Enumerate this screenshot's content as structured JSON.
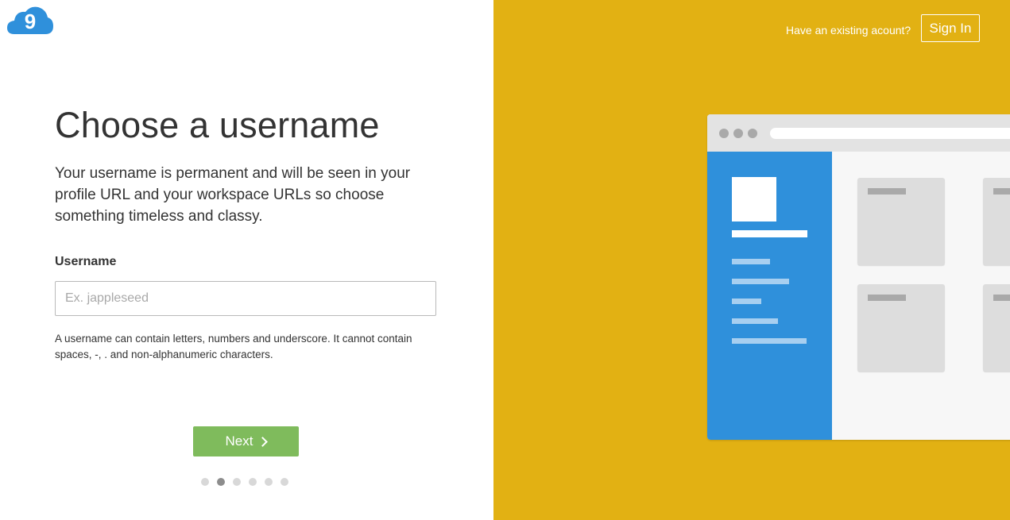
{
  "logo": {
    "icon": "cloud9-logo-icon",
    "glyph": "9",
    "color": "#2f90db"
  },
  "main": {
    "title": "Choose a username",
    "description": "Your username is permanent and will be seen in your profile URL and your workspace URLs so choose something timeless and classy.",
    "username_label": "Username",
    "username_value": "",
    "username_placeholder": "Ex. jappleseed",
    "hint": "A username can contain letters, numbers and underscore. It cannot contain spaces, -, . and non-alphanumeric characters.",
    "next_label": "Next",
    "next_icon": "chevron-right-icon",
    "progress": {
      "total_steps": 6,
      "current_step": 2
    }
  },
  "side": {
    "existing_text": "Have an existing acount?",
    "signin_label": "Sign In"
  },
  "colors": {
    "accent_yellow": "#e2b113",
    "next_green": "#7fbb5c",
    "illustration_blue": "#2f90db"
  }
}
